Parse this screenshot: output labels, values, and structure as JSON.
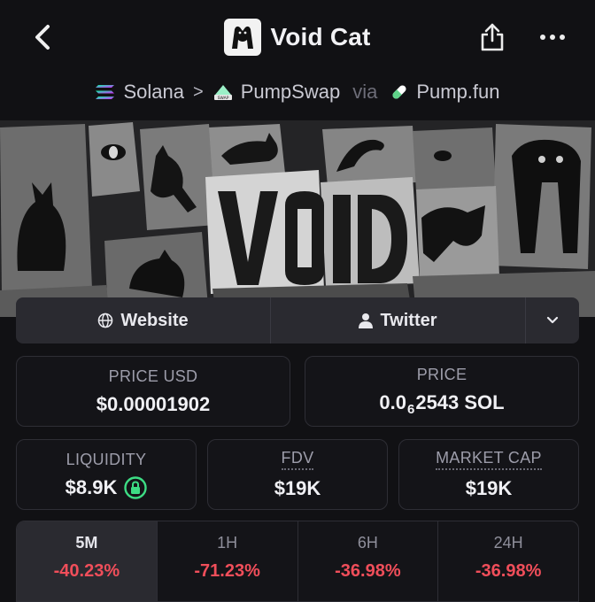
{
  "header": {
    "title": "Void Cat",
    "back_icon": "chevron-left-icon",
    "share_icon": "share-icon",
    "more_icon": "more-dots-icon"
  },
  "breadcrumb": {
    "chain": "Solana",
    "dex": "PumpSwap",
    "via": "via",
    "launchpad": "Pump.fun"
  },
  "banner": {
    "text": "VOID"
  },
  "links": {
    "website": "Website",
    "twitter": "Twitter"
  },
  "stats": {
    "price_usd_label": "PRICE USD",
    "price_usd_value": "$0.00001902",
    "price_label": "PRICE",
    "price_prefix": "0.0",
    "price_subscript": "6",
    "price_suffix": "2543 SOL",
    "liquidity_label": "LIQUIDITY",
    "liquidity_value": "$8.9K",
    "fdv_label": "FDV",
    "fdv_value": "$19K",
    "mcap_label": "MARKET CAP",
    "mcap_value": "$19K"
  },
  "timeframes": [
    {
      "label": "5M",
      "change": "-40.23%"
    },
    {
      "label": "1H",
      "change": "-71.23%"
    },
    {
      "label": "6H",
      "change": "-36.98%"
    },
    {
      "label": "24H",
      "change": "-36.98%"
    }
  ],
  "colors": {
    "negative": "#f04e5a",
    "lock_green": "#3ddc84",
    "background": "#111114"
  }
}
